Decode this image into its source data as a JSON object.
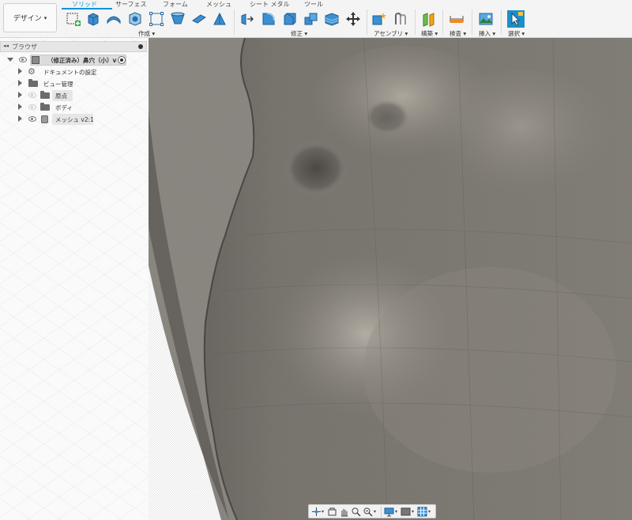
{
  "app": {
    "workspace_button": "デザイン",
    "workspace_caret": "▾"
  },
  "tabs": [
    {
      "label": "ソリッド",
      "active": true
    },
    {
      "label": "サーフェス"
    },
    {
      "label": "フォーム"
    },
    {
      "label": "メッシュ"
    },
    {
      "label": "シート メタル"
    },
    {
      "label": "ツール"
    }
  ],
  "toolbar": {
    "groups": [
      {
        "label": "作成 ▾"
      },
      {
        "label": "修正 ▾"
      },
      {
        "label": "アセンブリ ▾"
      },
      {
        "label": "構築 ▾"
      },
      {
        "label": "検査 ▾"
      },
      {
        "label": "挿入 ▾"
      },
      {
        "label": "選択 ▾"
      }
    ],
    "icons": [
      "create-sketch-icon",
      "extrude-icon",
      "revolve-icon",
      "hole-icon",
      "pattern-icon",
      "loft-icon",
      "rib-icon",
      "web-icon",
      "press-pull-icon",
      "fillet-icon",
      "chamfer-icon",
      "combine-icon",
      "shell-icon",
      "move-icon",
      "new-component-icon",
      "joint-icon",
      "offset-plane-icon",
      "measure-icon",
      "insert-image-icon",
      "select-icon"
    ],
    "accent": "#0696d7"
  },
  "browser": {
    "title": "ブラウザ",
    "root": {
      "label": "（修正済み）鼻穴（小）v"
    },
    "items": [
      {
        "label": "ドキュメントの設定"
      },
      {
        "label": "ビュー管理"
      },
      {
        "label": "原点"
      },
      {
        "label": "ボディ"
      },
      {
        "label": "メッシュ v2:1"
      }
    ]
  },
  "viewport": {
    "mesh_color": "#7d7a74",
    "background": "#ffffff"
  },
  "navbar": {
    "icons": [
      "orbit-icon",
      "look-at-icon",
      "pan-icon",
      "zoom-icon",
      "fit-icon",
      "display-settings-icon",
      "visual-style-icon",
      "grid-settings-icon"
    ]
  }
}
